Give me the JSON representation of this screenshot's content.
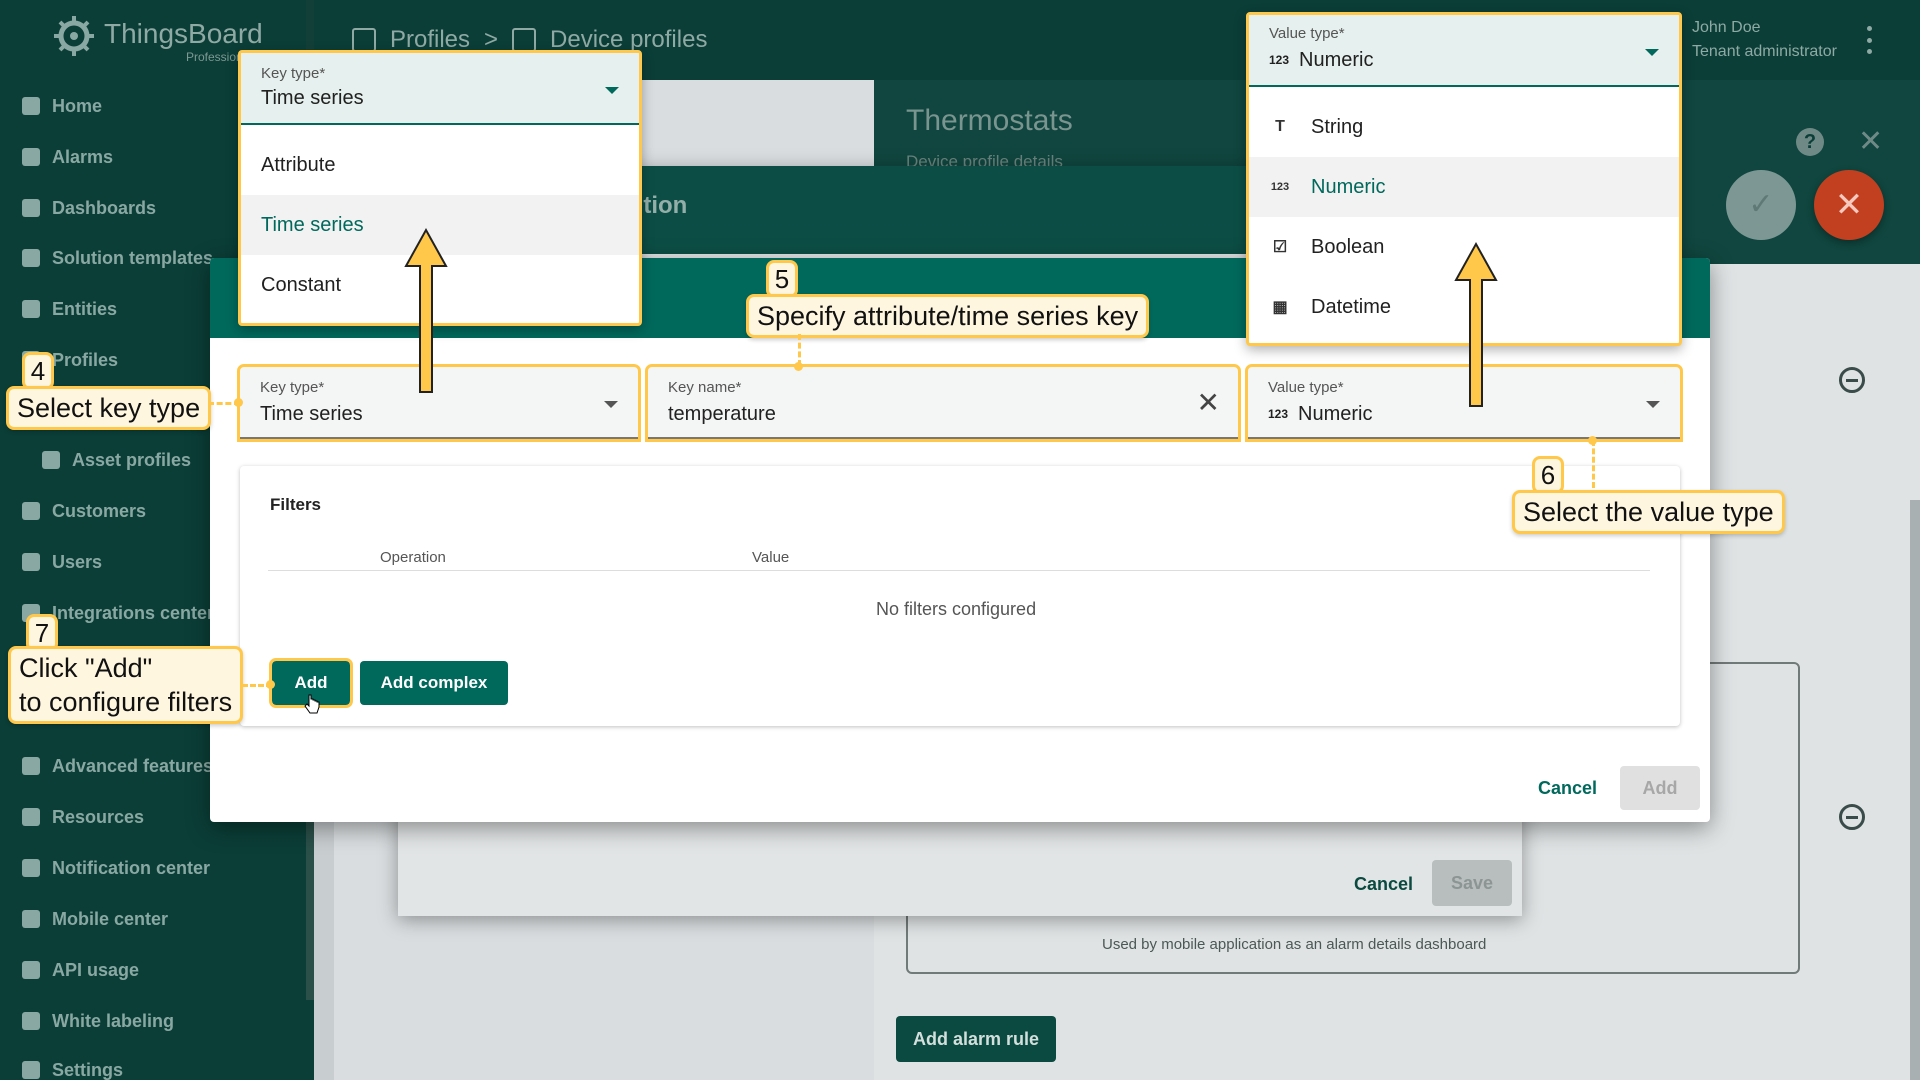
{
  "app": {
    "logo_text": "ThingsBoard",
    "logo_sub": "Professional",
    "breadcrumb": [
      "Profiles",
      ">",
      "Device profiles"
    ],
    "user_name": "John Doe",
    "user_role": "Tenant administrator"
  },
  "sidebar": {
    "items": [
      {
        "label": "Home",
        "icon": "home-icon"
      },
      {
        "label": "Alarms",
        "icon": "warning-icon"
      },
      {
        "label": "Dashboards",
        "icon": "dashboard-icon"
      },
      {
        "label": "Solution templates",
        "icon": "apps-icon"
      },
      {
        "label": "Entities",
        "icon": "entities-icon"
      },
      {
        "label": "Profiles",
        "icon": "profiles-icon"
      },
      {
        "label": "Asset profiles",
        "icon": "asset-profile-icon"
      },
      {
        "label": "Customers",
        "icon": "customers-icon"
      },
      {
        "label": "Users",
        "icon": "user-icon"
      },
      {
        "label": "Integrations center",
        "icon": "integrations-icon"
      },
      {
        "label": "Advanced features",
        "icon": "tools-icon"
      },
      {
        "label": "Resources",
        "icon": "folder-icon"
      },
      {
        "label": "Notification center",
        "icon": "notification-icon"
      },
      {
        "label": "Mobile center",
        "icon": "mobile-icon"
      },
      {
        "label": "API usage",
        "icon": "chart-icon"
      },
      {
        "label": "White labeling",
        "icon": "brush-icon"
      },
      {
        "label": "Settings",
        "icon": "settings-icon"
      }
    ]
  },
  "background": {
    "title": "Thermostats",
    "subtitle": "Device profile details",
    "middle_dialog_title": "lition",
    "middle_cancel": "Cancel",
    "middle_save": "Save",
    "mobile_hint": "Used by mobile application as an alarm details dashboard",
    "add_alarm_rule": "Add alarm rule"
  },
  "dialog": {
    "key_type": {
      "label": "Key type*",
      "value": "Time series"
    },
    "key_name": {
      "label": "Key name*",
      "value": "temperature"
    },
    "value_type": {
      "label": "Value type*",
      "value": "Numeric",
      "icon_text": "123"
    },
    "filters": {
      "title": "Filters",
      "columns": [
        "Operation",
        "Value"
      ],
      "empty": "No filters configured",
      "add_label": "Add",
      "add_complex_label": "Add complex"
    },
    "cancel_label": "Cancel",
    "submit_label": "Add"
  },
  "key_type_dropdown": {
    "label": "Key type*",
    "value": "Time series",
    "options": [
      "Attribute",
      "Time series",
      "Constant"
    ],
    "selected": "Time series"
  },
  "value_type_dropdown": {
    "label": "Value type*",
    "value": "Numeric",
    "icon_text": "123",
    "options": [
      {
        "label": "String",
        "icon": "T"
      },
      {
        "label": "Numeric",
        "icon": "123"
      },
      {
        "label": "Boolean",
        "icon": "☑"
      },
      {
        "label": "Datetime",
        "icon": "▦"
      }
    ],
    "selected": "Numeric"
  },
  "callouts": {
    "step4": {
      "num": "4",
      "text": "Select key type"
    },
    "step5": {
      "num": "5",
      "text": "Specify attribute/time series key"
    },
    "step6": {
      "num": "6",
      "text": "Select the value type"
    },
    "step7": {
      "num": "7",
      "line1": "Click \"Add\"",
      "line2": "to configure filters"
    }
  },
  "colors": {
    "primary": "#00695c",
    "topbar": "#0b3e37",
    "highlight": "#ffc84a",
    "fab_close": "#c2401f"
  }
}
